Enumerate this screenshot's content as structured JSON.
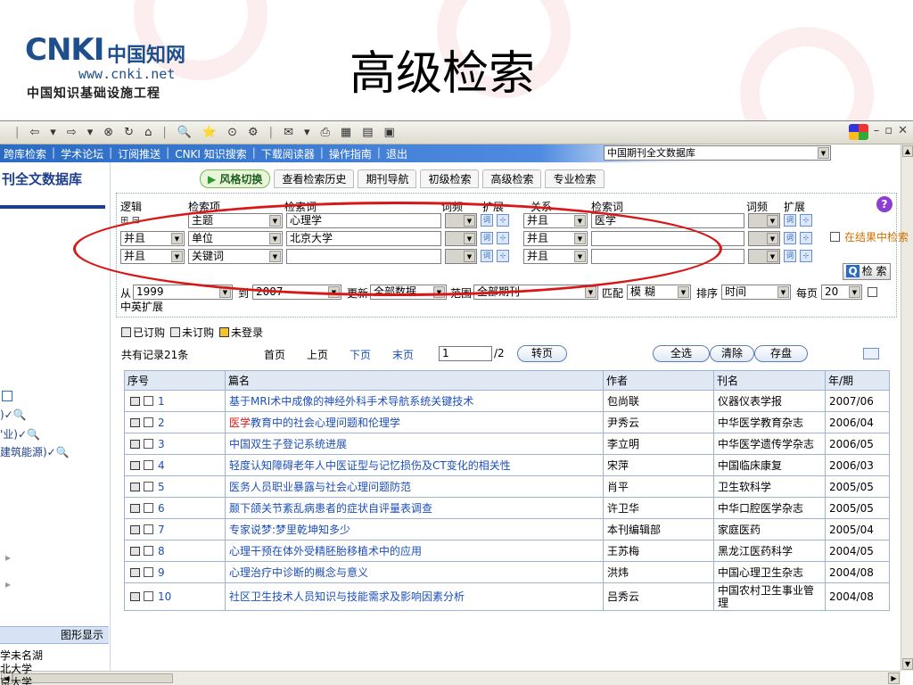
{
  "slide": {
    "title": "高级检索",
    "logo": {
      "mark": "CNKI",
      "name_cn": "中国知网",
      "url": "www.cnki.net",
      "slogan": "中国知识基础设施工程"
    }
  },
  "browser": {
    "toolbar_glyphs": [
      "|",
      "⇦",
      "▾",
      "⇨",
      "▾",
      "⊗",
      "↻",
      "⌂",
      "|",
      "🔍",
      "⭐",
      "⊙",
      "⚙",
      "|",
      "✉",
      "▾",
      "⎙",
      "▦",
      "▤",
      "▣"
    ],
    "window_controls": [
      "–",
      "▫",
      "✕"
    ]
  },
  "nav": {
    "links": [
      "跨库检索",
      "学术论坛",
      "订阅推送",
      "CNKI 知识搜索",
      "下载阅读器",
      "操作指南",
      "退出"
    ],
    "database_select": "中国期刊全文数据库"
  },
  "left_panel": {
    "db_title": "刊全文数据库",
    "items": [
      ")✓🔍",
      "'业)✓🔍",
      "建筑能源)✓🔍"
    ],
    "bullets": [
      "▸",
      "▸"
    ],
    "graph_button": "图形显示",
    "bottom_lines": [
      "学未名湖",
      "北大学",
      "京大学"
    ]
  },
  "tabs": [
    {
      "label": "风格切换"
    },
    {
      "label": "查看检索历史"
    },
    {
      "label": "期刊导航"
    },
    {
      "label": "初级检索"
    },
    {
      "label": "高级检索"
    },
    {
      "label": "专业检索"
    }
  ],
  "search": {
    "headers": {
      "logic": "逻辑",
      "field": "检索项",
      "term": "检索词",
      "freq": "词频",
      "expand": "扩展",
      "relation": "关系",
      "term2": "检索词",
      "freq2": "词频",
      "expand2": "扩展"
    },
    "rows": [
      {
        "logic": "",
        "field": "主题",
        "term": "心理学",
        "relation": "并且",
        "term2": "医学"
      },
      {
        "logic": "并且",
        "field": "单位",
        "term": "北京大学",
        "relation": "并且",
        "term2": ""
      },
      {
        "logic": "并且",
        "field": "关键词",
        "term": "",
        "relation": "并且",
        "term2": ""
      }
    ],
    "in_result": "在结果中检索",
    "search_button": "检 索",
    "time": {
      "from_label": "从",
      "from": "1999",
      "to_label": "到",
      "to": "2007",
      "update_label": "更新",
      "update": "全部数据",
      "range_label": "范围",
      "range": "全部期刊",
      "match_label": "匹配",
      "match": "模 糊",
      "sort_label": "排序",
      "sort": "时间",
      "per_page_label": "每页",
      "per_page": "20",
      "cn_en": "中英扩展"
    }
  },
  "status": {
    "subscribed": "已订购",
    "unsubscribed": "未订购",
    "not_logged": "未登录"
  },
  "pager": {
    "total": "共有记录21条",
    "first": "首页",
    "prev": "上页",
    "next": "下页",
    "last": "末页",
    "page_value": "1",
    "page_of": "/2",
    "go": "转页",
    "select_all": "全选",
    "clear": "清除",
    "save": "存盘"
  },
  "table": {
    "headers": [
      "序号",
      "篇名",
      "作者",
      "刊名",
      "年/期"
    ],
    "rows": [
      {
        "no": "1",
        "title_hl": "",
        "title": "基于MRI术中成像的神经外科手术导航系统关键技术",
        "author": "包尚联",
        "journal": "仪器仪表学报",
        "issue": "2007/06"
      },
      {
        "no": "2",
        "title_hl": "医学",
        "title": "教育中的社会心理问题和伦理学",
        "author": "尹秀云",
        "journal": "中华医学教育杂志",
        "issue": "2006/04"
      },
      {
        "no": "3",
        "title_hl": "",
        "title": "中国双生子登记系统进展",
        "author": "李立明",
        "journal": "中华医学遗传学杂志",
        "issue": "2006/05"
      },
      {
        "no": "4",
        "title_hl": "",
        "title": "轻度认知障碍老年人中医证型与记忆损伤及CT变化的相关性",
        "author": "宋萍",
        "journal": "中国临床康复",
        "issue": "2006/03"
      },
      {
        "no": "5",
        "title_hl": "",
        "title": "医务人员职业暴露与社会心理问题防范",
        "author": "肖平",
        "journal": "卫生软科学",
        "issue": "2005/05"
      },
      {
        "no": "6",
        "title_hl": "",
        "title": "颞下颌关节紊乱病患者的症状自评量表调查",
        "author": "许卫华",
        "journal": "中华口腔医学杂志",
        "issue": "2005/05"
      },
      {
        "no": "7",
        "title_hl": "",
        "title": "专家说梦:梦里乾坤知多少",
        "author": "本刊编辑部",
        "journal": "家庭医药",
        "issue": "2005/04"
      },
      {
        "no": "8",
        "title_hl": "",
        "title": "心理干预在体外受精胚胎移植术中的应用",
        "author": "王苏梅",
        "journal": "黑龙江医药科学",
        "issue": "2004/05"
      },
      {
        "no": "9",
        "title_hl": "",
        "title": "心理治疗中诊断的概念与意义",
        "author": "洪炜",
        "journal": "中国心理卫生杂志",
        "issue": "2004/08"
      },
      {
        "no": "10",
        "title_hl": "",
        "title": "社区卫生技术人员知识与技能需求及影响因素分析",
        "author": "吕秀云",
        "journal": "中国农村卫生事业管理",
        "issue": "2004/08"
      }
    ]
  },
  "colors": {
    "accent": "#1d4fb8",
    "highlight": "#d81818",
    "header_bg": "#dfe8f3",
    "ellipse": "#d81818"
  }
}
